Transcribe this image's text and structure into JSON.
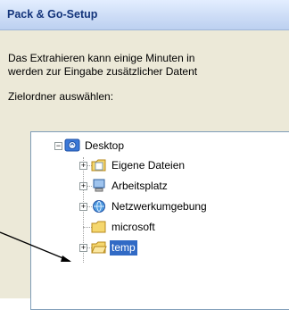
{
  "window": {
    "title": "Pack & Go-Setup"
  },
  "description": {
    "line1": "Das Extrahieren kann einige Minuten in",
    "line2": "werden zur Eingabe zusätzlicher Datent"
  },
  "folder_label": "Zielordner auswählen:",
  "tree": {
    "root": {
      "label": "Desktop",
      "expander": "−"
    },
    "children": [
      {
        "label": "Eigene Dateien",
        "expander": "+"
      },
      {
        "label": "Arbeitsplatz",
        "expander": "+"
      },
      {
        "label": "Netzwerkumgebung",
        "expander": "+"
      },
      {
        "label": "microsoft",
        "expander": ""
      },
      {
        "label": "temp",
        "expander": "+",
        "selected": true
      }
    ]
  },
  "colors": {
    "selection": "#316ac5",
    "folder": "#f5d76e",
    "title_text": "#14357b"
  },
  "icons": {
    "desktop": "desktop-icon",
    "eigene_dateien": "my-documents-folder-icon",
    "arbeitsplatz": "my-computer-icon",
    "netzwerkumgebung": "network-places-icon",
    "microsoft": "folder-icon",
    "temp": "open-folder-icon"
  }
}
